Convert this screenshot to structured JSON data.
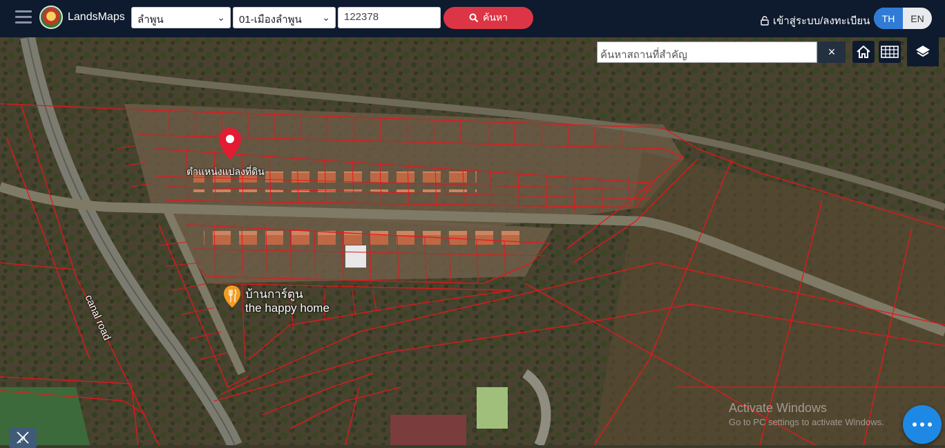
{
  "header": {
    "brand": "LandsMaps",
    "province": "ลำพูน",
    "district": "01-เมืองลำพูน",
    "parcel_number": "122378",
    "search_label": "ค้นหา",
    "login_label": "เข้าสู่ระบบ/ลงทะเบียน",
    "lang_th": "TH",
    "lang_en": "EN",
    "active_lang": "TH"
  },
  "map": {
    "place_search_placeholder": "ค้นหาสถานที่สำคัญ",
    "clear_symbol": "×",
    "marker_label": "ตำแหน่งแปลงที่ดิน",
    "poi_line1": "บ้านการ์ตูน",
    "poi_line2": "the happy home",
    "road_label": "canal road",
    "parcel_line_color": "#e8161b",
    "marker_color": "#e31b33"
  },
  "watermark": {
    "title": "Activate Windows",
    "subtitle": "Go to PC settings to activate Windows."
  },
  "icons": {
    "menu": "hamburger-icon",
    "search": "search-icon",
    "lock": "lock-icon",
    "home": "home-icon",
    "grid": "grid-icon",
    "layers": "layers-icon",
    "measure": "ruler-pencil-icon",
    "more": "more-dots-icon"
  },
  "colors": {
    "topbar": "#0e1a2e",
    "search_button": "#dc3545",
    "lang_active": "#2f7bd6",
    "fab": "#1e88e5"
  }
}
